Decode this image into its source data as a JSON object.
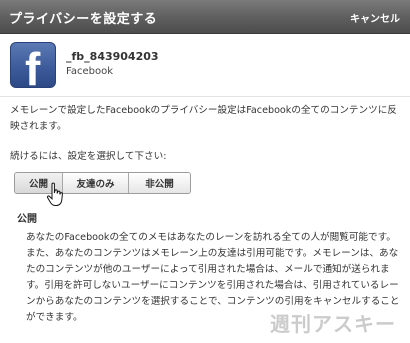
{
  "dialog": {
    "title": "プライバシーを設定する",
    "cancel_label": "キャンセル"
  },
  "app": {
    "id": "_fb_843904203",
    "name": "Facebook",
    "icon": "facebook-f-icon",
    "icon_color": "#3b5998"
  },
  "description": "メモレーンで設定したFacebookのプライバシー設定はFacebookの全てのコンテンツに反映されます。",
  "prompt": "続けるには、設定を選択して下さい:",
  "options": [
    {
      "label": "公開"
    },
    {
      "label": "友達のみ"
    },
    {
      "label": "非公開"
    }
  ],
  "selected": {
    "title": "公開",
    "description": "あなたのFacebookの全てのメモはあなたのレーンを訪れる全ての人が閲覧可能です。また、あなたのコンテンツはメモレーン上の友達は引用可能です。メモレーンは、あなたのコンテンツが他のユーザーによって引用された場合は、メールで通知が送られます。引用を許可しないユーザーにコンテンツを引用された場合は、引用されているレーンからあなたのコンテンツを選択することで、コンテンツの引用をキャンセルすることができます。"
  },
  "watermark": "週刊アスキー"
}
